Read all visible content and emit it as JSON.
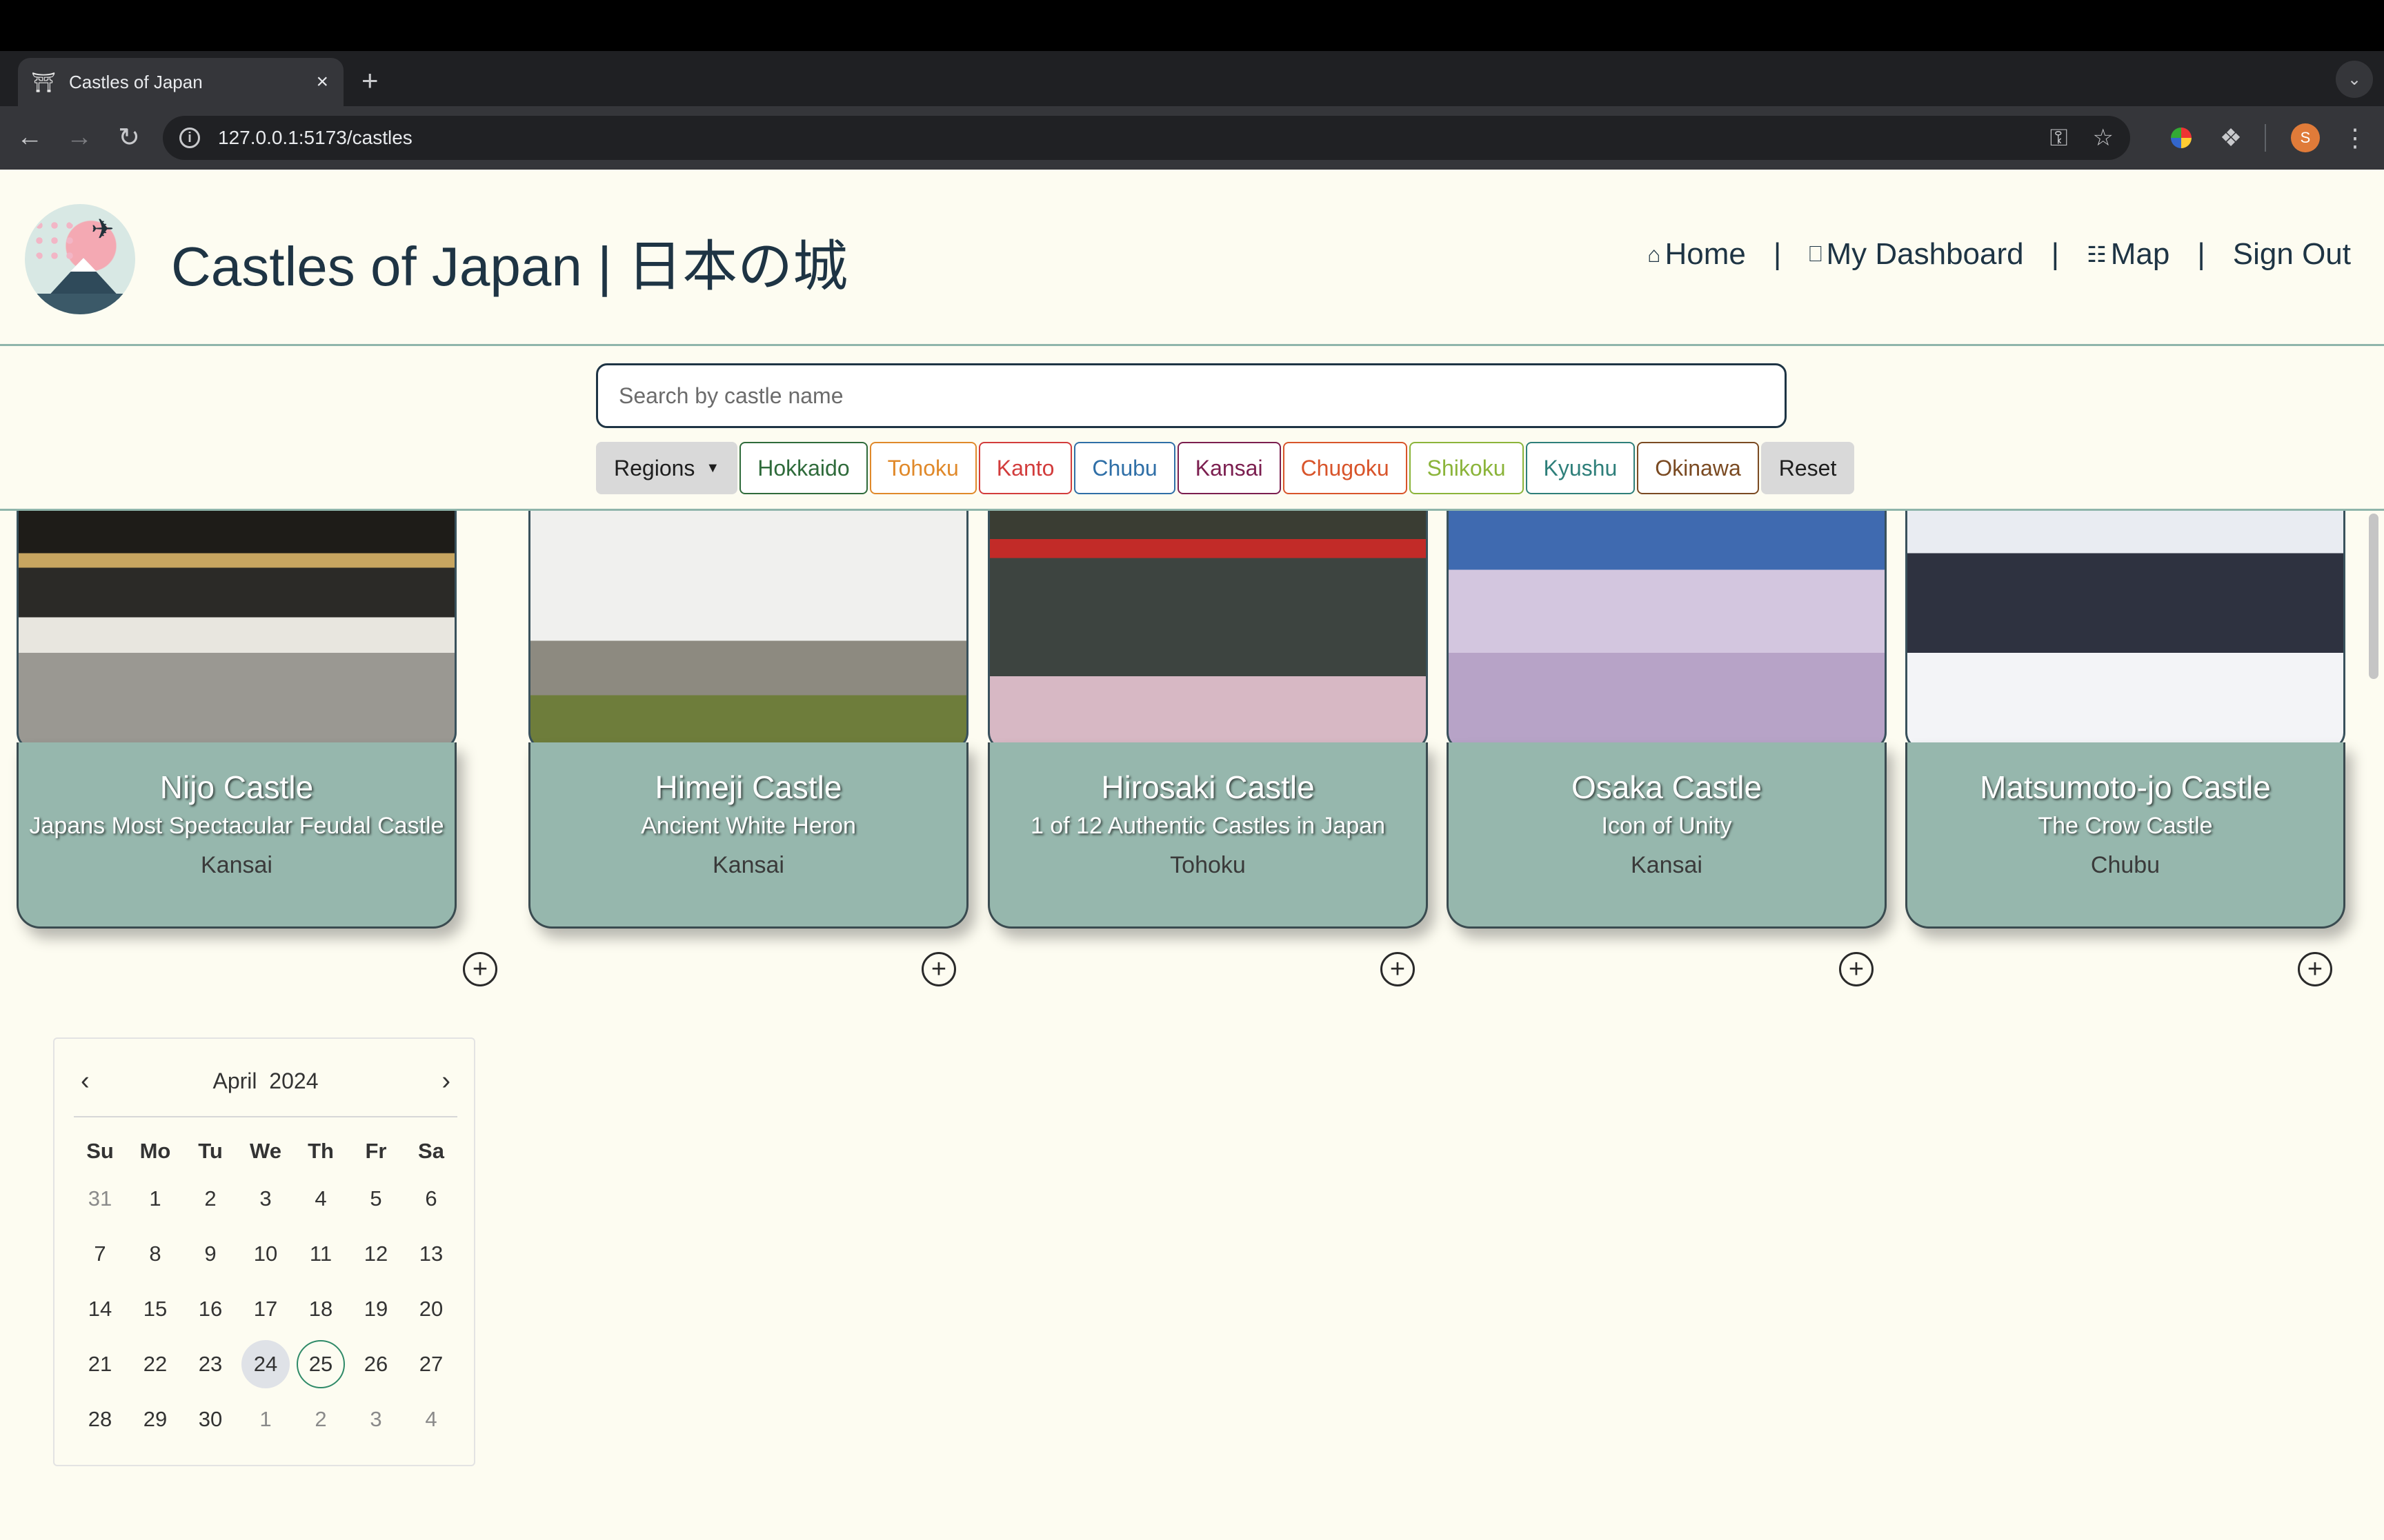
{
  "browser": {
    "tab_title": "Castles of Japan",
    "tab_close": "×",
    "new_tab": "+",
    "url": "127.0.0.1:5173/castles"
  },
  "header": {
    "title": "Castles of Japan | 日本の城",
    "nav": [
      {
        "label": "Home",
        "icon": "house-icon"
      },
      {
        "label": "My Dashboard",
        "icon": "monitor-icon"
      },
      {
        "label": "Map",
        "icon": "map-icon"
      },
      {
        "label": "Sign Out",
        "icon": ""
      }
    ],
    "separator": "|"
  },
  "search": {
    "placeholder": "Search by castle name",
    "value": ""
  },
  "filters": {
    "dropdown_label": "Regions",
    "regions": [
      {
        "label": "Hokkaido",
        "color": "#2f6b3b"
      },
      {
        "label": "Tohoku",
        "color": "#e0892a"
      },
      {
        "label": "Kanto",
        "color": "#d23c3c"
      },
      {
        "label": "Chubu",
        "color": "#2f6fa7"
      },
      {
        "label": "Kansai",
        "color": "#7b1e4f"
      },
      {
        "label": "Chugoku",
        "color": "#d8542a"
      },
      {
        "label": "Shikoku",
        "color": "#8bb43a"
      },
      {
        "label": "Kyushu",
        "color": "#2e7f7a"
      },
      {
        "label": "Okinawa",
        "color": "#7a4a22"
      }
    ],
    "reset_label": "Reset"
  },
  "castles": [
    {
      "name": "Nijo Castle",
      "tagline": "Japans Most Spectacular Feudal Castle",
      "region": "Kansai"
    },
    {
      "name": "Himeji Castle",
      "tagline": "Ancient White Heron",
      "region": "Kansai"
    },
    {
      "name": "Hirosaki Castle",
      "tagline": "1 of 12 Authentic Castles in Japan",
      "region": "Tohoku"
    },
    {
      "name": "Osaka Castle",
      "tagline": "Icon of Unity",
      "region": "Kansai"
    },
    {
      "name": "Matsumoto-jo Castle",
      "tagline": "The Crow Castle",
      "region": "Chubu"
    }
  ],
  "calendar": {
    "month": "April",
    "year": "2024",
    "weekdays": [
      "Su",
      "Mo",
      "Tu",
      "We",
      "Th",
      "Fr",
      "Sa"
    ],
    "weeks": [
      [
        "31",
        "1",
        "2",
        "3",
        "4",
        "5",
        "6"
      ],
      [
        "7",
        "8",
        "9",
        "10",
        "11",
        "12",
        "13"
      ],
      [
        "14",
        "15",
        "16",
        "17",
        "18",
        "19",
        "20"
      ],
      [
        "21",
        "22",
        "23",
        "24",
        "25",
        "26",
        "27"
      ],
      [
        "28",
        "29",
        "30",
        "1",
        "2",
        "3",
        "4"
      ]
    ],
    "today": "24",
    "selected": "25"
  }
}
